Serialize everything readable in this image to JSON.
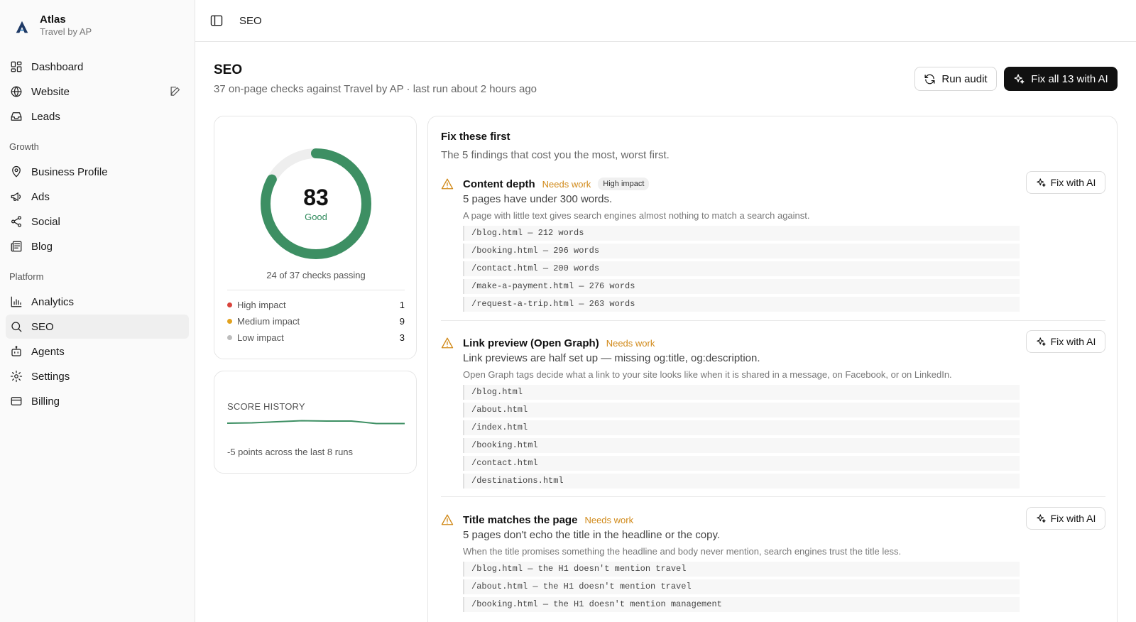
{
  "brand": {
    "title": "Atlas",
    "subtitle": "Travel by AP"
  },
  "nav": {
    "main": [
      {
        "label": "Dashboard",
        "icon": "dashboard-icon"
      },
      {
        "label": "Website",
        "icon": "globe-icon"
      },
      {
        "label": "Leads",
        "icon": "inbox-icon"
      }
    ],
    "growth_label": "Growth",
    "growth": [
      {
        "label": "Business Profile",
        "icon": "map-pin-icon"
      },
      {
        "label": "Ads",
        "icon": "megaphone-icon"
      },
      {
        "label": "Social",
        "icon": "share-icon"
      },
      {
        "label": "Blog",
        "icon": "newspaper-icon"
      }
    ],
    "platform_label": "Platform",
    "platform": [
      {
        "label": "Analytics",
        "icon": "bar-chart-icon"
      },
      {
        "label": "SEO",
        "icon": "search-icon",
        "active": true
      },
      {
        "label": "Agents",
        "icon": "bot-icon"
      },
      {
        "label": "Settings",
        "icon": "gear-icon"
      },
      {
        "label": "Billing",
        "icon": "credit-card-icon"
      }
    ]
  },
  "topbar": {
    "breadcrumb": "SEO"
  },
  "header": {
    "title": "SEO",
    "subtitle": "37 on-page checks against Travel by AP · last run about 2 hours ago",
    "run_audit": "Run audit",
    "fix_all": "Fix all 13 with AI"
  },
  "score": {
    "value": "83",
    "label": "Good",
    "fraction": 0.83,
    "checks": "24 of 37 checks passing",
    "impacts": [
      {
        "label": "High impact",
        "count": "1",
        "color": "#d9443c"
      },
      {
        "label": "Medium impact",
        "count": "9",
        "color": "#e2a21f"
      },
      {
        "label": "Low impact",
        "count": "3",
        "color": "#bdbdbd"
      }
    ]
  },
  "history": {
    "title": "SCORE HISTORY",
    "note": "-5 points across the last 8 runs"
  },
  "fixes": {
    "title": "Fix these first",
    "subtitle": "The 5 findings that cost you the most, worst first.",
    "button_label": "Fix with AI",
    "items": [
      {
        "name": "Content depth",
        "status": "Needs work",
        "badge": "High impact",
        "summary": "5 pages have under 300 words.",
        "desc": "A page with little text gives search engines almost nothing to match a search against.",
        "paths": [
          "/blog.html — 212 words",
          "/booking.html — 296 words",
          "/contact.html — 200 words",
          "/make-a-payment.html — 276 words",
          "/request-a-trip.html — 263 words"
        ]
      },
      {
        "name": "Link preview (Open Graph)",
        "status": "Needs work",
        "summary": "Link previews are half set up — missing og:title, og:description.",
        "desc": "Open Graph tags decide what a link to your site looks like when it is shared in a message, on Facebook, or on LinkedIn.",
        "paths": [
          "/blog.html",
          "/about.html",
          "/index.html",
          "/booking.html",
          "/contact.html",
          "/destinations.html"
        ]
      },
      {
        "name": "Title matches the page",
        "status": "Needs work",
        "summary": "5 pages don't echo the title in the headline or the copy.",
        "desc": "When the title promises something the headline and body never mention, search engines trust the title less.",
        "paths": [
          "/blog.html — the H1 doesn't mention travel",
          "/about.html — the H1 doesn't mention travel",
          "/booking.html — the H1 doesn't mention management"
        ]
      }
    ]
  }
}
